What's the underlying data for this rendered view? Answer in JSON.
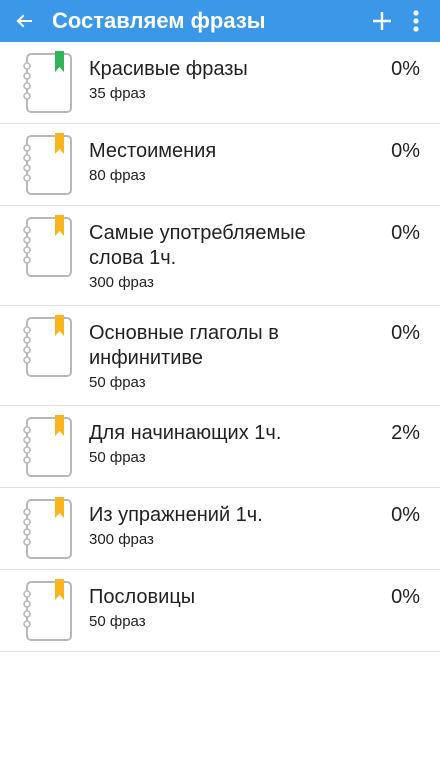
{
  "toolbar": {
    "title": "Составляем фразы",
    "back_icon": "arrow-left-icon",
    "add_icon": "plus-icon",
    "more_icon": "more-vertical-icon",
    "background": "#3b98e8"
  },
  "colors": {
    "bookmark_green": "#33b25a",
    "bookmark_yellow": "#f8b51e",
    "notebook_outline": "#b8b8b8"
  },
  "items": [
    {
      "name": "Красивые фразы",
      "count": "35 фраз",
      "percent": "0%",
      "bookmark": "green"
    },
    {
      "name": "Местоимения",
      "count": "80 фраз",
      "percent": "0%",
      "bookmark": "yellow"
    },
    {
      "name": "Самые употребляемые слова 1ч.",
      "count": "300 фраз",
      "percent": "0%",
      "bookmark": "yellow"
    },
    {
      "name": "Основные глаголы в инфинитиве",
      "count": "50 фраз",
      "percent": "0%",
      "bookmark": "yellow"
    },
    {
      "name": "Для начинающих 1ч.",
      "count": "50 фраз",
      "percent": "2%",
      "bookmark": "yellow"
    },
    {
      "name": "Из упражнений 1ч.",
      "count": "300 фраз",
      "percent": "0%",
      "bookmark": "yellow"
    },
    {
      "name": "Пословицы",
      "count": "50 фраз",
      "percent": "0%",
      "bookmark": "yellow"
    }
  ]
}
